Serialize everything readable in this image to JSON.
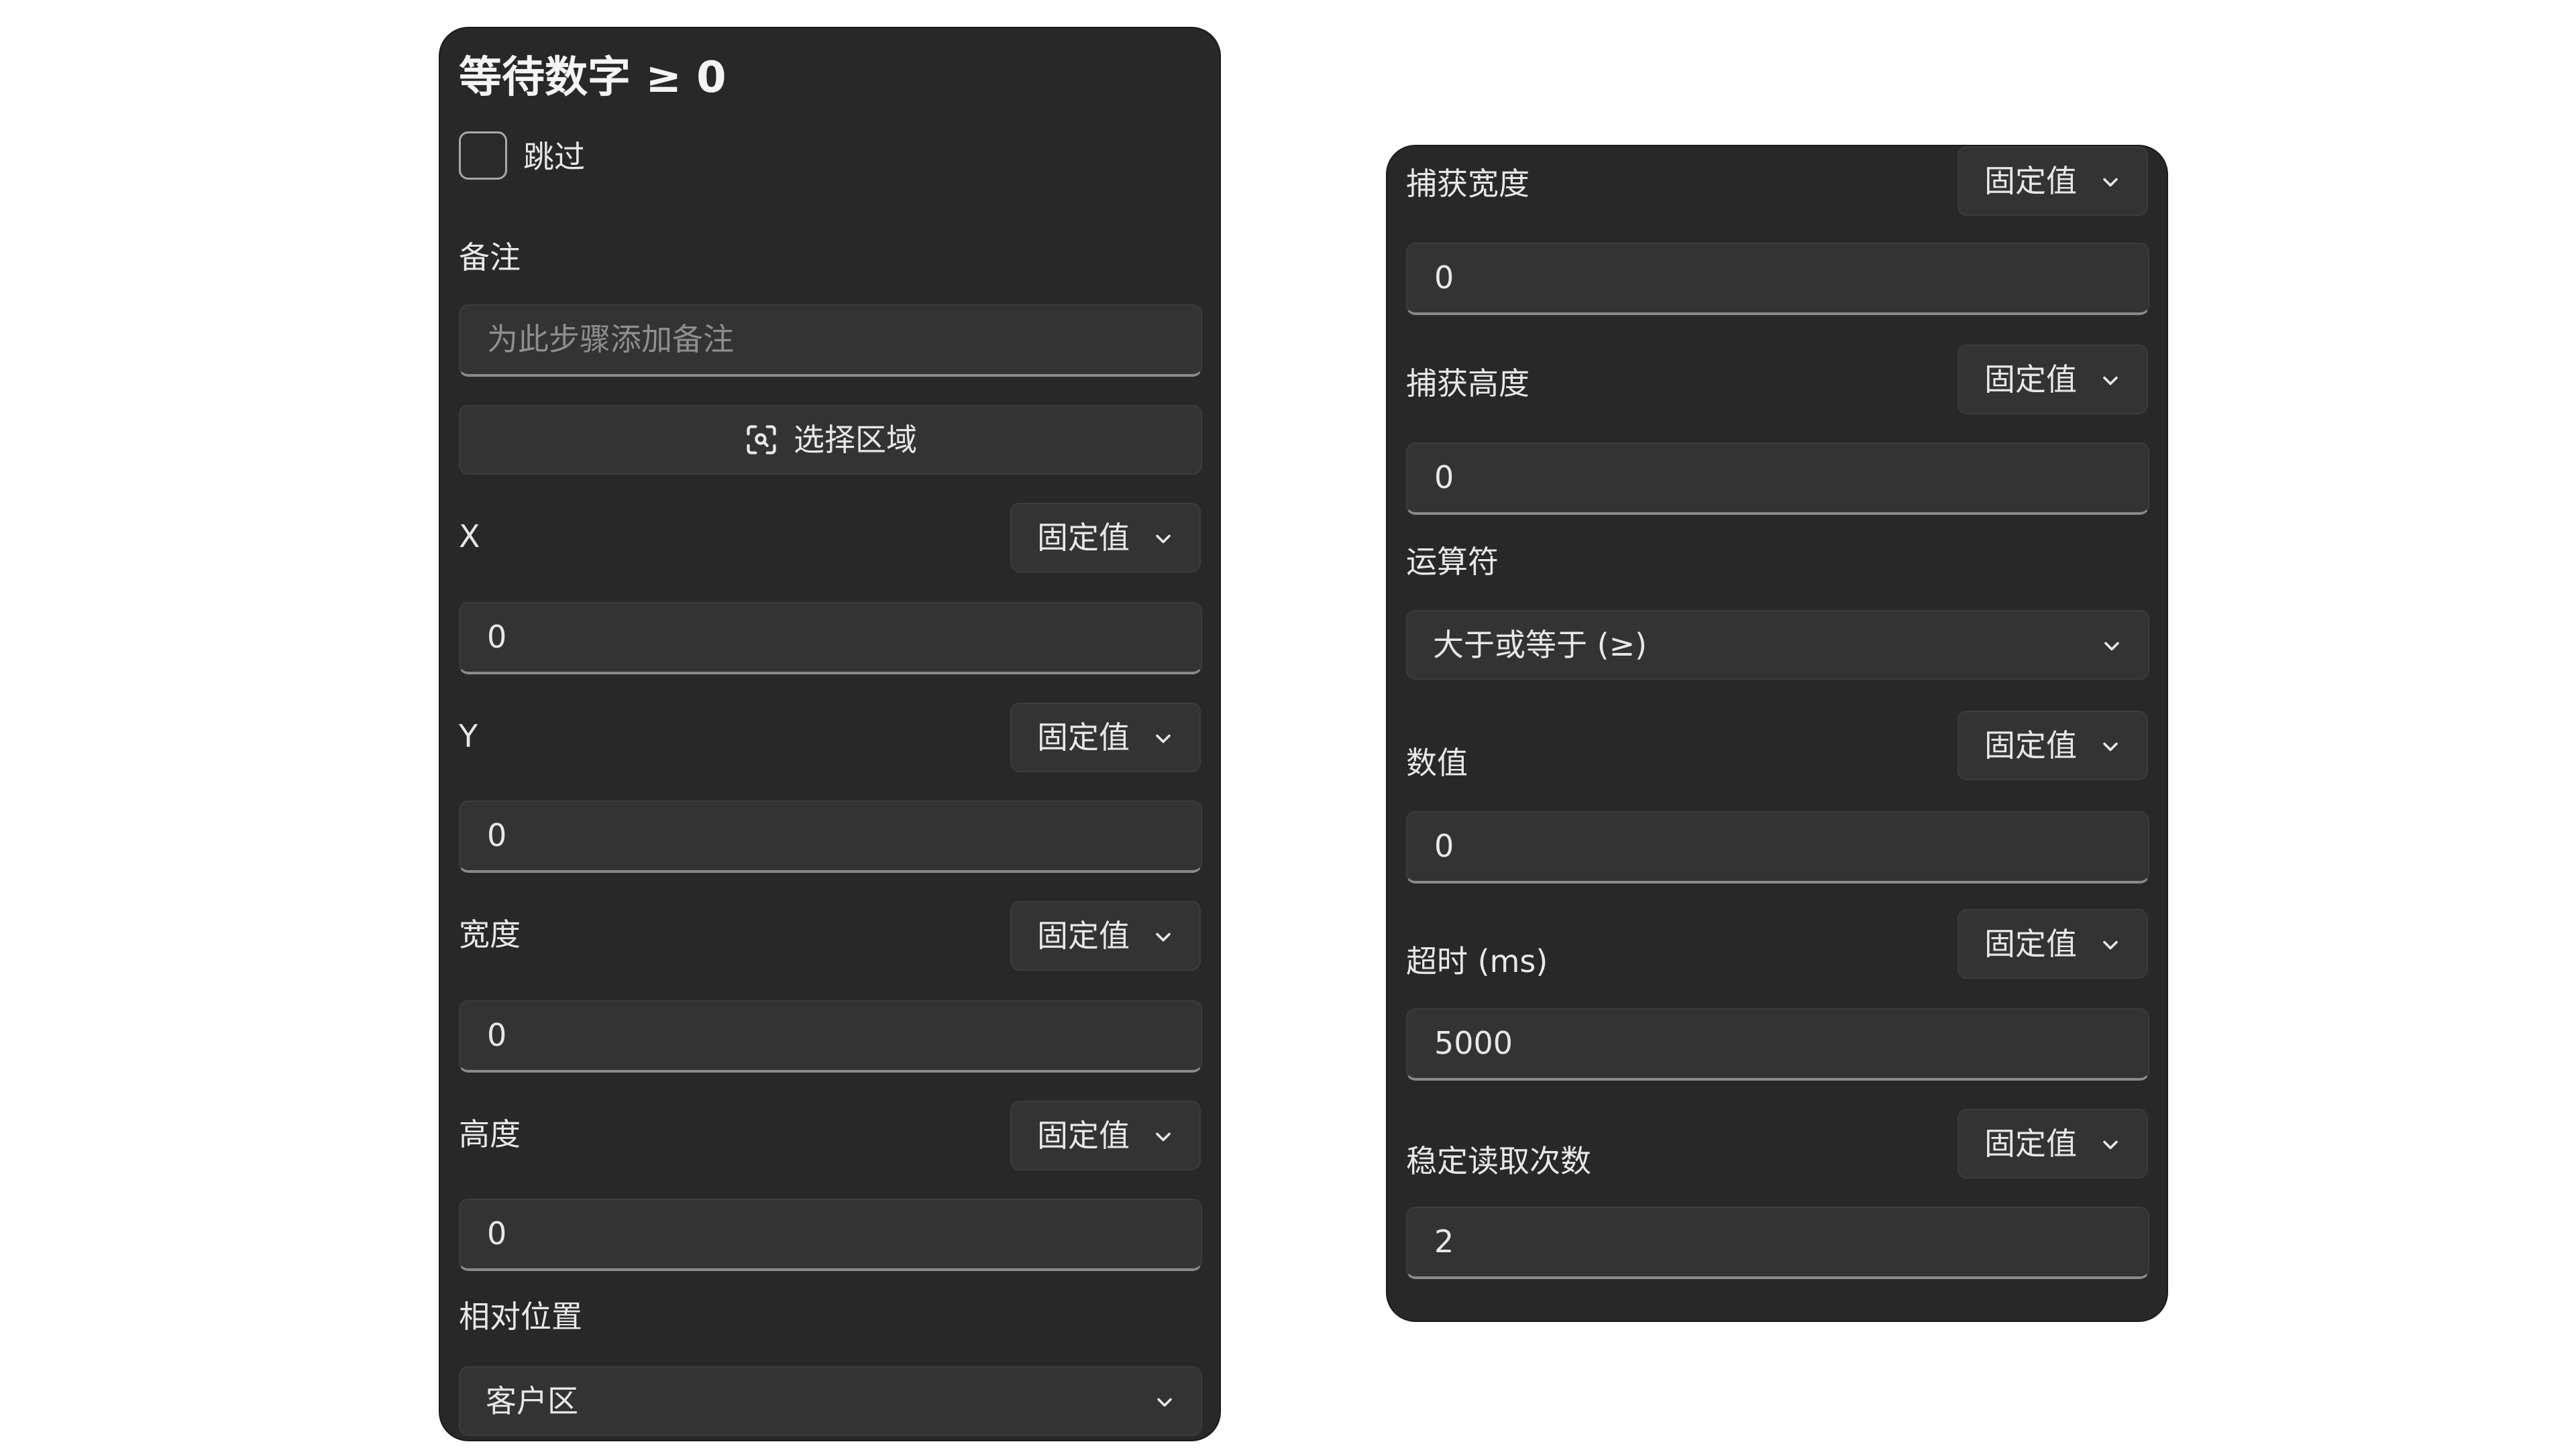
{
  "left_panel": {
    "title": "等待数字 ≥ 0",
    "skip_label": "跳过",
    "note_label": "备注",
    "note_placeholder": "为此步骤添加备注",
    "select_region_label": "选择区域",
    "fields": [
      {
        "label": "X",
        "mode": "固定值",
        "value": "0"
      },
      {
        "label": "Y",
        "mode": "固定值",
        "value": "0"
      },
      {
        "label": "宽度",
        "mode": "固定值",
        "value": "0"
      },
      {
        "label": "高度",
        "mode": "固定值",
        "value": "0"
      }
    ],
    "relative_position_label": "相对位置",
    "relative_position_value": "客户区"
  },
  "right_panel": {
    "fields_top": [
      {
        "label": "捕获宽度",
        "mode": "固定值",
        "value": "0"
      },
      {
        "label": "捕获高度",
        "mode": "固定值",
        "value": "0"
      }
    ],
    "operator_label": "运算符",
    "operator_value": "大于或等于 (≥)",
    "fields_bottom": [
      {
        "label": "数值",
        "mode": "固定值",
        "value": "0"
      },
      {
        "label": "超时 (ms)",
        "mode": "固定值",
        "value": "5000"
      },
      {
        "label": "稳定读取次数",
        "mode": "固定值",
        "value": "2"
      }
    ]
  },
  "icons": {
    "select_region": "focus-scan-icon",
    "dropdown": "chevron-down-icon"
  },
  "colors": {
    "panel_bg": "#282828",
    "control_bg": "#333333",
    "text": "#e8e8e8",
    "placeholder": "#8e8e8e",
    "underline": "#8a8a8a"
  }
}
